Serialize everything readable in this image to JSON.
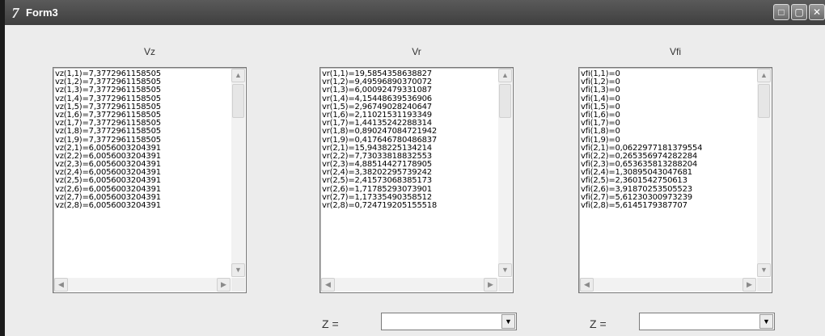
{
  "window": {
    "title": "Form3"
  },
  "columns": [
    {
      "label": "Vz",
      "items": [
        "vz(1,1)=7,3772961158505",
        "vz(1,2)=7,3772961158505",
        "vz(1,3)=7,3772961158505",
        "vz(1,4)=7,3772961158505",
        "vz(1,5)=7,3772961158505",
        "vz(1,6)=7,3772961158505",
        "vz(1,7)=7,3772961158505",
        "vz(1,8)=7,3772961158505",
        "vz(1,9)=7,3772961158505",
        "vz(2,1)=6,0056003204391",
        "vz(2,2)=6,0056003204391",
        "vz(2,3)=6,0056003204391",
        "vz(2,4)=6,0056003204391",
        "vz(2,5)=6,0056003204391",
        "vz(2,6)=6,0056003204391",
        "vz(2,7)=6,0056003204391",
        "vz(2,8)=6,0056003204391"
      ]
    },
    {
      "label": "Vr",
      "items": [
        "vr(1,1)=19,5854358638827",
        "vr(1,2)=9,49596890370072",
        "vr(1,3)=6,00092479331087",
        "vr(1,4)=4,15448639536906",
        "vr(1,5)=2,96749028240647",
        "vr(1,6)=2,11021531193349",
        "vr(1,7)=1,44135242288314",
        "vr(1,8)=0,890247084721942",
        "vr(1,9)=0,417646780486837",
        "vr(2,1)=15,9438225134214",
        "vr(2,2)=7,73033818832553",
        "vr(2,3)=4,88514427178905",
        "vr(2,4)=3,38202295739242",
        "vr(2,5)=2,41573068385173",
        "vr(2,6)=1,71785293073901",
        "vr(2,7)=1,17335490358512",
        "vr(2,8)=0,724719205155518"
      ]
    },
    {
      "label": "Vfi",
      "items": [
        "vfi(1,1)=0",
        "vfi(1,2)=0",
        "vfi(1,3)=0",
        "vfi(1,4)=0",
        "vfi(1,5)=0",
        "vfi(1,6)=0",
        "vfi(1,7)=0",
        "vfi(1,8)=0",
        "vfi(1,9)=0",
        "vfi(2,1)=0,0622977181379554",
        "vfi(2,2)=0,265356974282284",
        "vfi(2,3)=0,653635813288204",
        "vfi(2,4)=1,30895043047681",
        "vfi(2,5)=2,3601542750613",
        "vfi(2,6)=3,91870253505523",
        "vfi(2,7)=5,61230300973239",
        "vfi(2,8)=5,6145179387707"
      ]
    }
  ],
  "z_controls": [
    {
      "label": "Z =",
      "value": ""
    },
    {
      "label": "Z =",
      "value": ""
    }
  ],
  "icons": {
    "app": "delphi-form-icon",
    "minimize": "minimize-icon",
    "maximize": "maximize-icon",
    "close": "close-icon"
  }
}
